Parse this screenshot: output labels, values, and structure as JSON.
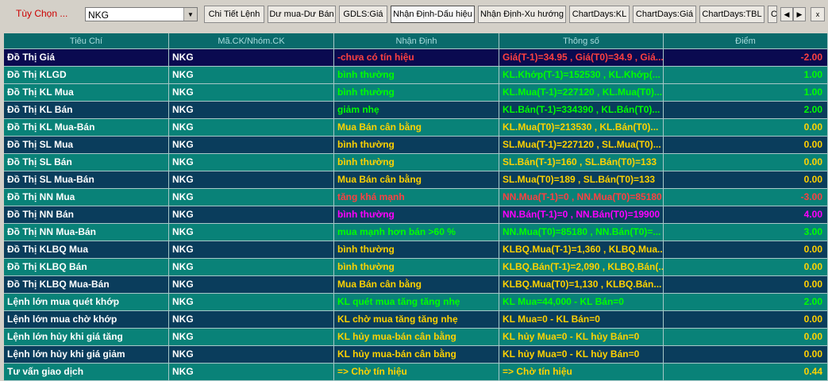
{
  "toolbar": {
    "label": "Tùy Chọn ...",
    "symbol": "NKG",
    "buttons": [
      "Chi Tiết Lệnh",
      "Dư mua-Dư Bán",
      "GDLS:Giá",
      "Nhận Định-Dấu hiệu",
      "Nhận Định-Xu hướng",
      "ChartDays:KL",
      "ChartDays:Giá",
      "ChartDays:TBL",
      "C"
    ],
    "active_button": "Nhận Định-Dấu hiệu",
    "nav_prev": "◀",
    "nav_next": "▶",
    "close": "x"
  },
  "table": {
    "headers": [
      "Tiêu Chí",
      "Mã.CK/Nhóm.CK",
      "Nhận Định",
      "Thông số",
      "Điểm"
    ],
    "rows": [
      {
        "criterion": "Đồ Thị Giá",
        "code": "NKG",
        "assessment": "-chưa có tín hiệu",
        "params": "Giá(T-1)=34.95 , Giá(T0)=34.9 , Giá...",
        "score": "-2.00"
      },
      {
        "criterion": "Đồ Thị KLGD",
        "code": "NKG",
        "assessment": "bình thường",
        "params": "KL.Khớp(T-1)=152530 , KL.Khớp(...",
        "score": "1.00"
      },
      {
        "criterion": "Đồ Thị KL Mua",
        "code": "NKG",
        "assessment": "bình thường",
        "params": "KL.Mua(T-1)=227120 , KL.Mua(T0)...",
        "score": "1.00"
      },
      {
        "criterion": "Đồ Thị KL Bán",
        "code": "NKG",
        "assessment": "giảm nhẹ",
        "params": "KL.Bán(T-1)=334390 , KL.Bán(T0)...",
        "score": "2.00"
      },
      {
        "criterion": "Đồ Thị KL Mua-Bán",
        "code": "NKG",
        "assessment": "Mua Bán cân bằng",
        "params": "KL.Mua(T0)=213530 , KL.Bán(T0)...",
        "score": "0.00"
      },
      {
        "criterion": "Đồ Thị SL Mua",
        "code": "NKG",
        "assessment": "bình thường",
        "params": "SL.Mua(T-1)=227120 , SL.Mua(T0)...",
        "score": "0.00"
      },
      {
        "criterion": "Đồ Thị SL Bán",
        "code": "NKG",
        "assessment": "bình thường",
        "params": "SL.Bán(T-1)=160 , SL.Bán(T0)=133",
        "score": "0.00"
      },
      {
        "criterion": "Đồ Thị SL Mua-Bán",
        "code": "NKG",
        "assessment": "Mua Bán cân bằng",
        "params": "SL.Mua(T0)=189 , SL.Bán(T0)=133",
        "score": "0.00"
      },
      {
        "criterion": "Đồ Thị NN Mua",
        "code": "NKG",
        "assessment": "tăng khá mạnh",
        "params": "NN.Mua(T-1)=0 , NN.Mua(T0)=85180",
        "score": "-3.00"
      },
      {
        "criterion": "Đồ Thị NN Bán",
        "code": "NKG",
        "assessment": "bình thường",
        "params": "NN.Bán(T-1)=0 , NN.Bán(T0)=19900",
        "score": "4.00"
      },
      {
        "criterion": "Đồ Thị NN Mua-Bán",
        "code": "NKG",
        "assessment": "mua mạnh hơn bán >60 %",
        "params": "NN.Mua(T0)=85180 , NN.Bán(T0)=...",
        "score": "3.00"
      },
      {
        "criterion": "Đồ Thị KLBQ Mua",
        "code": "NKG",
        "assessment": "bình thường",
        "params": "KLBQ.Mua(T-1)=1,360 , KLBQ.Mua...",
        "score": "0.00"
      },
      {
        "criterion": "Đồ Thị KLBQ Bán",
        "code": "NKG",
        "assessment": "bình thường",
        "params": "KLBQ.Bán(T-1)=2,090 , KLBQ.Bán(...",
        "score": "0.00"
      },
      {
        "criterion": "Đồ Thị KLBQ Mua-Bán",
        "code": "NKG",
        "assessment": "Mua Bán cân bằng",
        "params": "KLBQ.Mua(T0)=1,130 , KLBQ.Bán...",
        "score": "0.00"
      },
      {
        "criterion": "Lệnh lớn mua quét khớp",
        "code": "NKG",
        "assessment": "KL quét mua tăng tăng nhẹ",
        "params": "KL Mua=44,000 - KL Bán=0",
        "score": "2.00"
      },
      {
        "criterion": "Lệnh lớn mua chờ khớp",
        "code": "NKG",
        "assessment": "KL chờ mua tăng tăng nhẹ",
        "params": "KL Mua=0 - KL Bán=0",
        "score": "0.00"
      },
      {
        "criterion": "Lệnh lớn hủy khi giá tăng",
        "code": "NKG",
        "assessment": "KL hủy mua-bán cân bằng",
        "params": "KL hủy Mua=0 - KL hủy Bán=0",
        "score": "0.00"
      },
      {
        "criterion": "Lệnh lớn hủy khi giá giảm",
        "code": "NKG",
        "assessment": "KL hủy mua-bán cân bằng",
        "params": "KL hủy Mua=0 - KL hủy Bán=0",
        "score": "0.00"
      },
      {
        "criterion": "Tư vấn giao dịch",
        "code": "NKG",
        "assessment": "=> Chờ tín hiệu",
        "params": "=> Chờ tín hiệu",
        "score": "0.44"
      }
    ]
  },
  "colors": {
    "header_bg": "#096a6b",
    "header_text": "#a8dcdc",
    "row_dark": "#0a3d5c",
    "row_teal": "#098278",
    "row_first": "#0a0a50",
    "negative": "#ff4040",
    "positive": "#00ff00",
    "neutral": "#ffd200",
    "magenta": "#ff00ff"
  },
  "row_styles": [
    {
      "bg": "#0a0a50",
      "color": "#ff4040"
    },
    {
      "bg": "#098278",
      "color": "#00ff00"
    },
    {
      "bg": "#098278",
      "color": "#00ff00"
    },
    {
      "bg": "#0a3d5c",
      "color": "#00ff00"
    },
    {
      "bg": "#098278",
      "color": "#ffd200"
    },
    {
      "bg": "#0a3d5c",
      "color": "#ffd200"
    },
    {
      "bg": "#098278",
      "color": "#ffd200"
    },
    {
      "bg": "#0a3d5c",
      "color": "#ffd200"
    },
    {
      "bg": "#098278",
      "color": "#ff4040"
    },
    {
      "bg": "#0a3d5c",
      "color": "#ff00ff"
    },
    {
      "bg": "#098278",
      "color": "#00ff00"
    },
    {
      "bg": "#0a3d5c",
      "color": "#ffd200"
    },
    {
      "bg": "#098278",
      "color": "#ffd200"
    },
    {
      "bg": "#0a3d5c",
      "color": "#ffd200"
    },
    {
      "bg": "#098278",
      "color": "#00ff00"
    },
    {
      "bg": "#0a3d5c",
      "color": "#ffd200"
    },
    {
      "bg": "#098278",
      "color": "#ffd200"
    },
    {
      "bg": "#0a3d5c",
      "color": "#ffd200"
    },
    {
      "bg": "#098278",
      "color": "#ffd200"
    }
  ]
}
